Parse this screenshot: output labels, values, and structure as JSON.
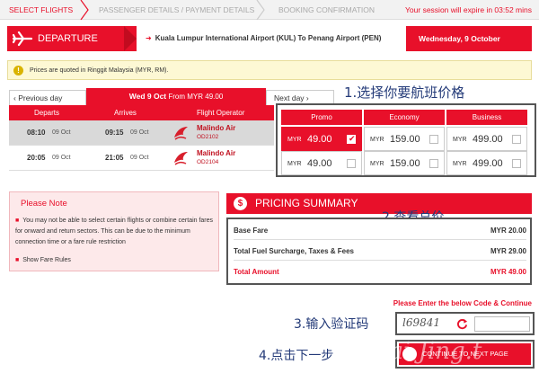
{
  "steps": [
    {
      "label": "SELECT FLIGHTS"
    },
    {
      "label": "PASSENGER DETAILS / PAYMENT DETAILS"
    },
    {
      "label": "BOOKING CONFIRMATION"
    }
  ],
  "session": "Your session will expire in 03:52 mins",
  "departure": {
    "label": "DEPARTURE",
    "route": "Kuala Lumpur International Airport (KUL) To Penang Airport (PEN)",
    "date": "Wednesday, 9 October"
  },
  "info": "Prices are quoted in Ringgit Malaysia (MYR, RM).",
  "date_nav": {
    "prev": "‹  Previous day",
    "current_day": "Wed 9 Oct",
    "current_from": "From MYR 49.00",
    "next": "Next day  ›"
  },
  "flight_table": {
    "headers": [
      "Departs",
      "Arrives",
      "Flight Operator"
    ],
    "rows": [
      {
        "dep_time": "08:10",
        "dep_date": "09 Oct",
        "arr_time": "09:15",
        "arr_date": "09 Oct",
        "operator": "Malindo Air",
        "code": "OD2102",
        "selected": true
      },
      {
        "dep_time": "20:05",
        "dep_date": "09 Oct",
        "arr_time": "21:05",
        "arr_date": "09 Oct",
        "operator": "Malindo Air",
        "code": "OD2104",
        "selected": false
      }
    ]
  },
  "fares": {
    "headers": [
      "Promo",
      "Economy",
      "Business"
    ],
    "currency": "MYR",
    "rows": [
      [
        {
          "amount": "49.00",
          "selected": true
        },
        {
          "amount": "159.00",
          "selected": false
        },
        {
          "amount": "499.00",
          "selected": false
        }
      ],
      [
        {
          "amount": "49.00",
          "selected": false
        },
        {
          "amount": "159.00",
          "selected": false
        },
        {
          "amount": "499.00",
          "selected": false
        }
      ]
    ]
  },
  "annotations": {
    "a1": "1.选择你要航班价格",
    "a2": "2.查看总价",
    "a3": "3.输入验证码",
    "a4": "4.点击下一步"
  },
  "note": {
    "title": "Please Note",
    "text": "You may not be able to select certain flights or combine certain fares for onward and return sectors. This can be due to the minimum connection time or a fare rule restriction",
    "link": "Show Fare Rules"
  },
  "pricing": {
    "title": "PRICING SUMMARY",
    "rows": [
      {
        "label": "Base Fare",
        "value": "MYR 20.00"
      },
      {
        "label": "Total Fuel Surcharge, Taxes & Fees",
        "value": "MYR 29.00"
      },
      {
        "label": "Total Amount",
        "value": "MYR 49.00"
      }
    ]
  },
  "captcha": {
    "prompt": "Please Enter the below Code & Continue",
    "code": "l69841",
    "input_value": ""
  },
  "continue_label": "CONTINUE TO NEXT PAGE",
  "watermark": "e-Lai Jing.t",
  "colors": {
    "brand_red": "#e8102a",
    "annotation_blue": "#233a78"
  }
}
